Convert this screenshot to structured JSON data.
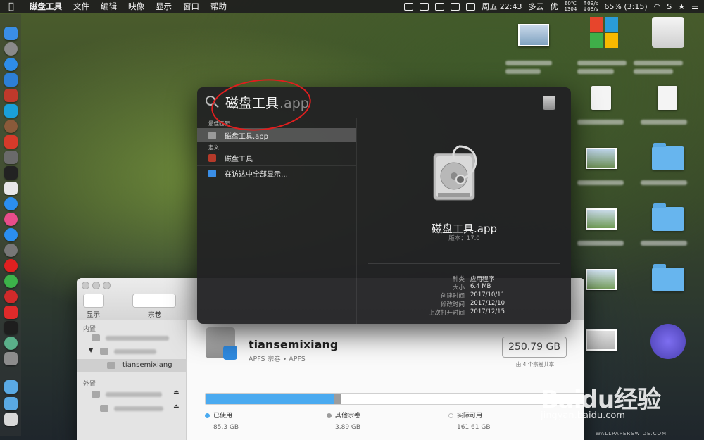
{
  "menubar": {
    "apple": "",
    "app_name": "磁盘工具",
    "items": [
      "文件",
      "编辑",
      "映像",
      "显示",
      "窗口",
      "帮助"
    ],
    "status": {
      "clock": "周五 22:43",
      "weather": "多云",
      "ime": "优",
      "temp_top": "60℃",
      "temp_bottom": "1304",
      "net_up": "↑0B/s",
      "net_down": "↓0B/s",
      "battery": "65% (3:15)"
    }
  },
  "spotlight": {
    "query": "磁盘工具",
    "query_suffix": ".app",
    "sections": {
      "top_hit": "最佳匹配",
      "definition": "定义"
    },
    "results": [
      {
        "label": "磁盘工具.app",
        "selected": true,
        "icon": "disk-utility-icon"
      },
      {
        "label": "磁盘工具",
        "selected": false,
        "icon": "dictionary-icon"
      },
      {
        "label": "在访达中全部显示…",
        "selected": false,
        "icon": "finder-icon"
      }
    ],
    "preview": {
      "name": "磁盘工具.app",
      "version": "版本：17.0",
      "info": [
        {
          "key": "种类",
          "value": "应用程序"
        },
        {
          "key": "大小",
          "value": "6.4 MB"
        },
        {
          "key": "创建时间",
          "value": "2017/10/11"
        },
        {
          "key": "修改时间",
          "value": "2017/12/10"
        },
        {
          "key": "上次打开时间",
          "value": "2017/12/15"
        }
      ]
    }
  },
  "disk_utility": {
    "toolbar": {
      "view_label": "显示",
      "volume_label": "宗卷"
    },
    "sidebar": {
      "internal": "内置",
      "external": "外置",
      "selected_volume": "tiansemixiang"
    },
    "volume": {
      "name": "tiansemixiang",
      "subtitle": "APFS 宗卷 • APFS",
      "size": "250.79 GB",
      "shared_note": "由 4 个宗卷共享"
    },
    "usage": [
      {
        "label": "已使用",
        "value": "85.3 GB",
        "color": "#4aaaf0",
        "fraction": 0.34
      },
      {
        "label": "其他宗卷",
        "value": "3.89 GB",
        "color": "#9c9c9c",
        "fraction": 0.016
      },
      {
        "label": "实际可用",
        "value": "161.61 GB",
        "color": "#ffffff",
        "fraction": 0.644
      }
    ]
  },
  "watermark": {
    "baidu": "Baidu经验",
    "url": "jingyan.baidu.com",
    "wallpaper": "WALLPAPERSWIDE.COM"
  }
}
